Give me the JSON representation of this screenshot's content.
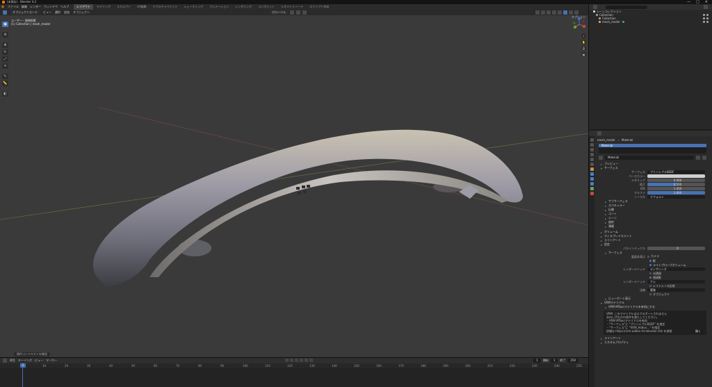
{
  "app": {
    "title": "(未保存) - Blender 4.2",
    "window_controls": [
      "—",
      "□",
      "✕"
    ]
  },
  "menu": [
    "ファイル",
    "編集",
    "レンダー",
    "ウィンドウ",
    "ヘルプ"
  ],
  "workspace_tabs": [
    "レイアウト",
    "モデリング",
    "スカルプト",
    "UV編集",
    "テクスチャペイント",
    "シェーディング",
    "アニメーション",
    "レンダリング",
    "コンポジット",
    "ジオメトリノード",
    "スクリプト作成"
  ],
  "topright": {
    "scene": "Scene",
    "viewlayer": "ViewLayer"
  },
  "viewport": {
    "mode": "オブジェクトモード",
    "header_menus": [
      "ビュー",
      "選択",
      "追加",
      "オブジェクト"
    ],
    "transform": "グローバル",
    "info_line1": "ユーザー・透視投影",
    "info_line2": "(1) Collection | mesh_model",
    "options_label": "オプション",
    "status_pill": "操作コンテキストを確認"
  },
  "outliner": {
    "title": "シーンコレクション",
    "rows": [
      {
        "name": "Collection",
        "color": "#9a9a9a"
      },
      {
        "name": "Collection",
        "color": "#9a9a9a"
      },
      {
        "name": "mesh_model",
        "color": "#e8a06a"
      }
    ]
  },
  "properties": {
    "breadcrumb_obj": "mesh_model",
    "breadcrumb_mat": "Material",
    "slot": "Material",
    "material_name": "Material",
    "sections": {
      "preview": "プレビュー",
      "surface": "サーフェス",
      "surface_label": "サーフェス",
      "surface_value": "プリンシプルBSDF",
      "base_color_label": "ベースカラー",
      "metallic_label": "メタリック",
      "metallic_value": "0.000",
      "roughness_label": "粗さ",
      "roughness_value": "0.500",
      "ior_label": "IOR",
      "ior_value": "1.450",
      "alpha_label": "アルファ",
      "alpha_value": "1.000",
      "normal_label": "ノーマル",
      "normal_value": "デフォルト",
      "subs": [
        "サブサーフェス",
        "スペキュラー",
        "伝播",
        "コート",
        "シーン",
        "放射",
        "薄膜"
      ],
      "volume": "ボリューム",
      "displacement": "ディスプレイスメント",
      "line_art": "ラインアート",
      "settings": "設定",
      "pass_index_label": "パスインデックス",
      "pass_index_value": "0",
      "surface2": "サーフェス",
      "backface_label": "裏面非表示",
      "backface_value": "カメラ",
      "shadow": "影",
      "light_probe": "ライトプローブボリューム",
      "render_method_label": "レンダーメソッド",
      "render_method_value": "ディザリング",
      "alpha_light": "光透過",
      "transparent_shadow": "透過影",
      "thickness_label": "レンダーメソッド",
      "thickness_value": "ナシ",
      "raytrace": "レイトレース反射",
      "screen_space": "オブジェクト",
      "viewport_display": "ビューポート表示",
      "normal_space_label": "法線",
      "normal_space_value": "実装",
      "vrm_material": "VRMマテリアル",
      "vrm_sub": "VRM MToonマテリアルを有効にする",
      "info_lines": [
        "VRM: このマテリアルはエクスポートされません",
        "次のいずれかの条件を満たしてください。",
        "・VRM MToonマテリアルを有効",
        "・\"サーフェス\"に \"プリンシプルBSDF\" を指定",
        "・\"サーフェス\"に \"VRM_Addon...\" を指定",
        "詳細は https://vrm-addon-for-blender.info を参照"
      ],
      "open_label": "開く",
      "line_style": "ラインアート",
      "custom_props": "カスタムプロパティ"
    }
  },
  "timeline": {
    "menus": [
      "再生",
      "キーイング",
      "ビュー",
      "マーカー"
    ],
    "current_frame": "1",
    "start_label": "開始",
    "start": "1",
    "end_label": "終了",
    "end": "250",
    "ticks": [
      "0",
      "10",
      "20",
      "30",
      "40",
      "50",
      "60",
      "70",
      "80",
      "90",
      "100",
      "110",
      "120",
      "130",
      "140",
      "150",
      "160",
      "170",
      "180",
      "190",
      "200",
      "210",
      "220",
      "230",
      "240",
      "250"
    ]
  }
}
